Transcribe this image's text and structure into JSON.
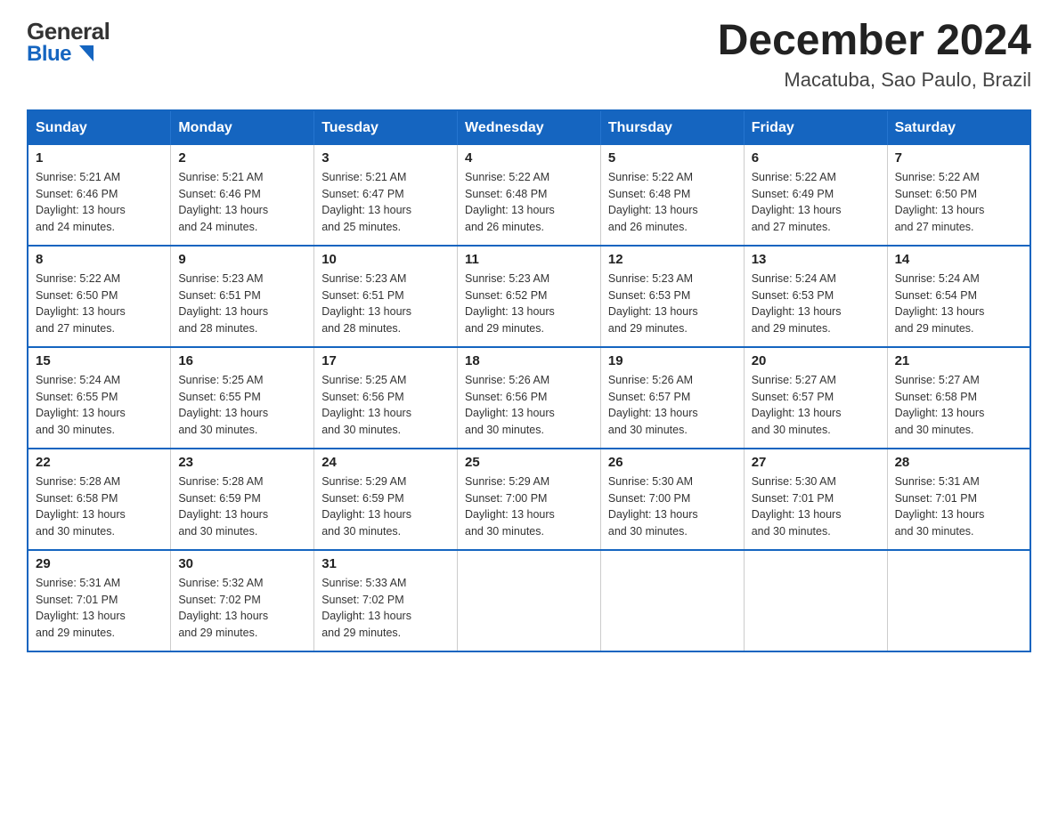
{
  "header": {
    "logo_general": "General",
    "logo_blue": "Blue",
    "month_title": "December 2024",
    "location": "Macatuba, Sao Paulo, Brazil"
  },
  "weekdays": [
    "Sunday",
    "Monday",
    "Tuesday",
    "Wednesday",
    "Thursday",
    "Friday",
    "Saturday"
  ],
  "weeks": [
    [
      {
        "day": "1",
        "sunrise": "5:21 AM",
        "sunset": "6:46 PM",
        "daylight": "13 hours and 24 minutes."
      },
      {
        "day": "2",
        "sunrise": "5:21 AM",
        "sunset": "6:46 PM",
        "daylight": "13 hours and 24 minutes."
      },
      {
        "day": "3",
        "sunrise": "5:21 AM",
        "sunset": "6:47 PM",
        "daylight": "13 hours and 25 minutes."
      },
      {
        "day": "4",
        "sunrise": "5:22 AM",
        "sunset": "6:48 PM",
        "daylight": "13 hours and 26 minutes."
      },
      {
        "day": "5",
        "sunrise": "5:22 AM",
        "sunset": "6:48 PM",
        "daylight": "13 hours and 26 minutes."
      },
      {
        "day": "6",
        "sunrise": "5:22 AM",
        "sunset": "6:49 PM",
        "daylight": "13 hours and 27 minutes."
      },
      {
        "day": "7",
        "sunrise": "5:22 AM",
        "sunset": "6:50 PM",
        "daylight": "13 hours and 27 minutes."
      }
    ],
    [
      {
        "day": "8",
        "sunrise": "5:22 AM",
        "sunset": "6:50 PM",
        "daylight": "13 hours and 27 minutes."
      },
      {
        "day": "9",
        "sunrise": "5:23 AM",
        "sunset": "6:51 PM",
        "daylight": "13 hours and 28 minutes."
      },
      {
        "day": "10",
        "sunrise": "5:23 AM",
        "sunset": "6:51 PM",
        "daylight": "13 hours and 28 minutes."
      },
      {
        "day": "11",
        "sunrise": "5:23 AM",
        "sunset": "6:52 PM",
        "daylight": "13 hours and 29 minutes."
      },
      {
        "day": "12",
        "sunrise": "5:23 AM",
        "sunset": "6:53 PM",
        "daylight": "13 hours and 29 minutes."
      },
      {
        "day": "13",
        "sunrise": "5:24 AM",
        "sunset": "6:53 PM",
        "daylight": "13 hours and 29 minutes."
      },
      {
        "day": "14",
        "sunrise": "5:24 AM",
        "sunset": "6:54 PM",
        "daylight": "13 hours and 29 minutes."
      }
    ],
    [
      {
        "day": "15",
        "sunrise": "5:24 AM",
        "sunset": "6:55 PM",
        "daylight": "13 hours and 30 minutes."
      },
      {
        "day": "16",
        "sunrise": "5:25 AM",
        "sunset": "6:55 PM",
        "daylight": "13 hours and 30 minutes."
      },
      {
        "day": "17",
        "sunrise": "5:25 AM",
        "sunset": "6:56 PM",
        "daylight": "13 hours and 30 minutes."
      },
      {
        "day": "18",
        "sunrise": "5:26 AM",
        "sunset": "6:56 PM",
        "daylight": "13 hours and 30 minutes."
      },
      {
        "day": "19",
        "sunrise": "5:26 AM",
        "sunset": "6:57 PM",
        "daylight": "13 hours and 30 minutes."
      },
      {
        "day": "20",
        "sunrise": "5:27 AM",
        "sunset": "6:57 PM",
        "daylight": "13 hours and 30 minutes."
      },
      {
        "day": "21",
        "sunrise": "5:27 AM",
        "sunset": "6:58 PM",
        "daylight": "13 hours and 30 minutes."
      }
    ],
    [
      {
        "day": "22",
        "sunrise": "5:28 AM",
        "sunset": "6:58 PM",
        "daylight": "13 hours and 30 minutes."
      },
      {
        "day": "23",
        "sunrise": "5:28 AM",
        "sunset": "6:59 PM",
        "daylight": "13 hours and 30 minutes."
      },
      {
        "day": "24",
        "sunrise": "5:29 AM",
        "sunset": "6:59 PM",
        "daylight": "13 hours and 30 minutes."
      },
      {
        "day": "25",
        "sunrise": "5:29 AM",
        "sunset": "7:00 PM",
        "daylight": "13 hours and 30 minutes."
      },
      {
        "day": "26",
        "sunrise": "5:30 AM",
        "sunset": "7:00 PM",
        "daylight": "13 hours and 30 minutes."
      },
      {
        "day": "27",
        "sunrise": "5:30 AM",
        "sunset": "7:01 PM",
        "daylight": "13 hours and 30 minutes."
      },
      {
        "day": "28",
        "sunrise": "5:31 AM",
        "sunset": "7:01 PM",
        "daylight": "13 hours and 30 minutes."
      }
    ],
    [
      {
        "day": "29",
        "sunrise": "5:31 AM",
        "sunset": "7:01 PM",
        "daylight": "13 hours and 29 minutes."
      },
      {
        "day": "30",
        "sunrise": "5:32 AM",
        "sunset": "7:02 PM",
        "daylight": "13 hours and 29 minutes."
      },
      {
        "day": "31",
        "sunrise": "5:33 AM",
        "sunset": "7:02 PM",
        "daylight": "13 hours and 29 minutes."
      },
      null,
      null,
      null,
      null
    ]
  ],
  "labels": {
    "sunrise": "Sunrise:",
    "sunset": "Sunset:",
    "daylight": "Daylight:"
  }
}
